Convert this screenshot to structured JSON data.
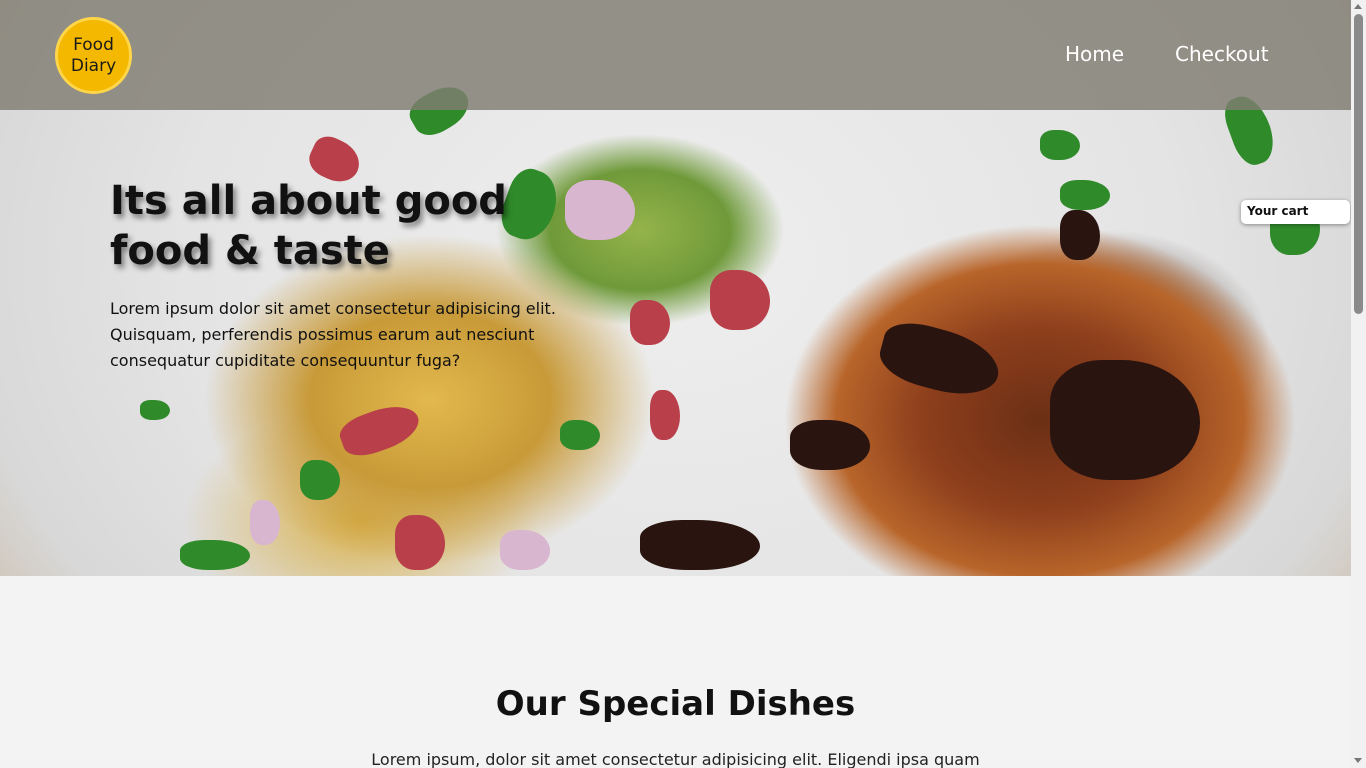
{
  "logo": {
    "line1": "Food",
    "line2": "Diary"
  },
  "nav": {
    "home": "Home",
    "checkout": "Checkout"
  },
  "hero": {
    "title": "Its all about good food & taste",
    "text": "Lorem ipsum dolor sit amet consectetur adipisicing elit. Quisquam, perferendis possimus earum aut nesciunt consequatur cupiditate consequuntur fuga?"
  },
  "cart": {
    "label": "Your cart"
  },
  "specials": {
    "title": "Our Special Dishes",
    "text": "Lorem ipsum, dolor sit amet consectetur adipisicing elit. Eligendi ipsa quam"
  },
  "colors": {
    "logo_bg": "#f5b800",
    "navbar_bg": "rgba(128,124,114,0.82)"
  }
}
